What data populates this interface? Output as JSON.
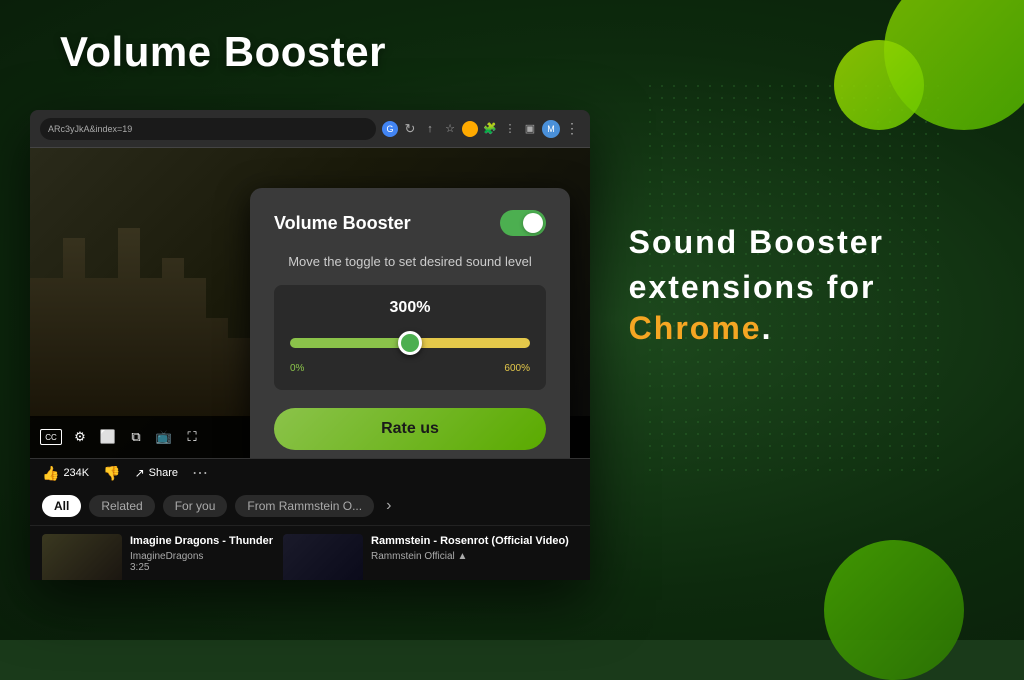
{
  "page": {
    "title": "Volume Booster",
    "bg_color": "#0d2a0d"
  },
  "right_section": {
    "line1": "Sound Booster",
    "line2": "extensions for",
    "chrome_word": "Chrome",
    "period": "."
  },
  "extension_popup": {
    "title": "Volume Booster",
    "toggle_state": "on",
    "subtitle": "Move the toggle to set desired sound level",
    "percentage": "300%",
    "slider_min": "0%",
    "slider_max": "600%",
    "rate_button": "Rate us"
  },
  "browser_bar": {
    "address": "ARc3yJkA&index=19"
  },
  "youtube": {
    "tabs": [
      {
        "label": "All",
        "active": true
      },
      {
        "label": "Related",
        "active": false
      },
      {
        "label": "For you",
        "active": false
      },
      {
        "label": "From Rammstein O...",
        "active": false
      }
    ],
    "videos": [
      {
        "title": "Imagine Dragons - Thunder",
        "channel": "ImagineDragons",
        "duration": "3:25"
      },
      {
        "title": "Rammstein - Rosenrot (Official Video)",
        "channel": "Rammstein Official ▲"
      }
    ],
    "likes": "234K",
    "share_label": "Share"
  }
}
